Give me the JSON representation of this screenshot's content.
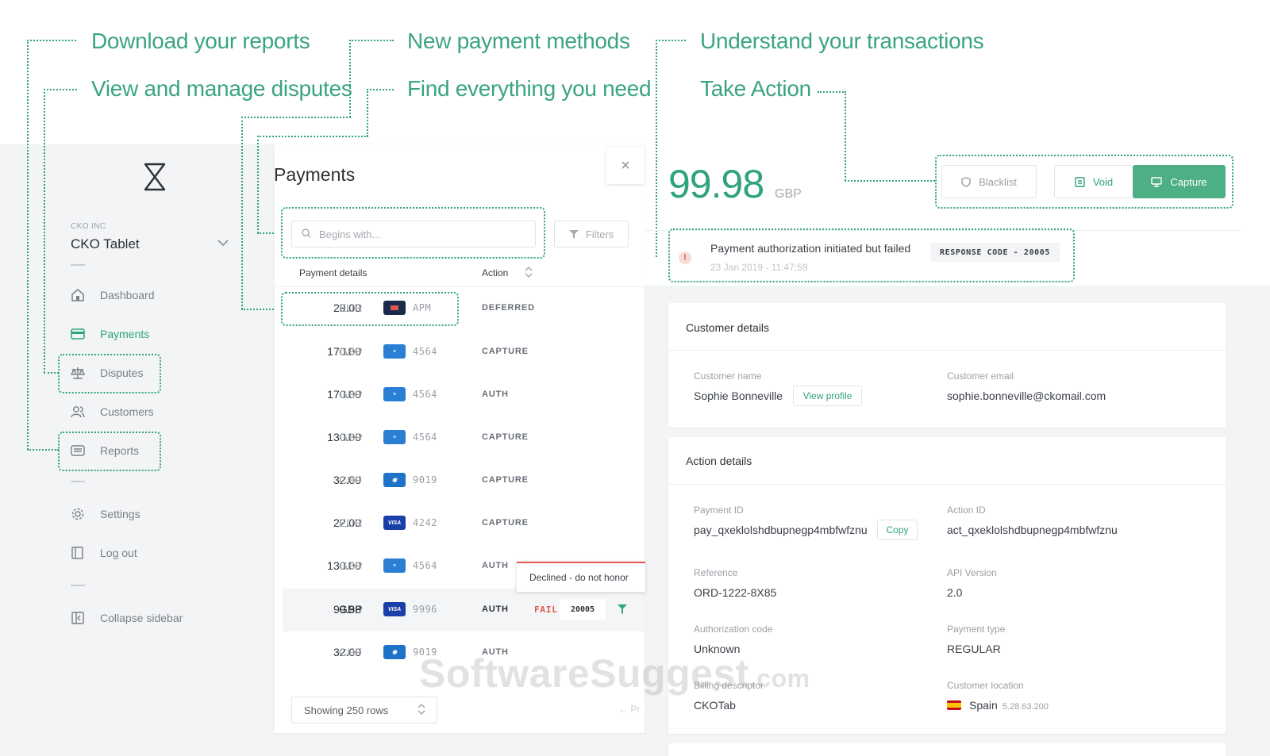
{
  "callouts": {
    "download_reports": "Download your reports",
    "view_disputes": "View and manage disputes",
    "new_payment_methods": "New payment methods",
    "find_everything": "Find everything you need",
    "understand_transactions": "Understand your transactions",
    "take_action": "Take Action"
  },
  "sidebar": {
    "org_sub": "CKO INC",
    "org_name": "CKO Tablet",
    "items": [
      {
        "label": "Dashboard",
        "icon": "dashboard-icon"
      },
      {
        "label": "Payments",
        "icon": "payments-icon",
        "active": true
      },
      {
        "label": "Disputes",
        "icon": "scales-icon"
      },
      {
        "label": "Customers",
        "icon": "customers-icon"
      },
      {
        "label": "Reports",
        "icon": "reports-icon"
      },
      {
        "label": "Settings",
        "icon": "gear-icon"
      },
      {
        "label": "Log out",
        "icon": "logout-icon"
      },
      {
        "label": "Collapse sidebar",
        "icon": "collapse-icon"
      }
    ]
  },
  "payments": {
    "title": "Payments",
    "close": "×",
    "search_placeholder": "Begins with...",
    "filters_label": "Filters",
    "col_details": "Payment details",
    "col_action": "Action",
    "rows": [
      {
        "amount": "29.00",
        "currency": "EUR",
        "method": "APM",
        "action": "DEFERRED"
      },
      {
        "amount": "170.00",
        "currency": "GBP",
        "method": "4564",
        "action": "CAPTURE"
      },
      {
        "amount": "170.00",
        "currency": "GBP",
        "method": "4564",
        "action": "AUTH"
      },
      {
        "amount": "130.00",
        "currency": "GBP",
        "method": "4564",
        "action": "CAPTURE"
      },
      {
        "amount": "32.00",
        "currency": "CHF",
        "method": "9019",
        "action": "CAPTURE"
      },
      {
        "amount": "22.00",
        "currency": "EUR",
        "method": "4242",
        "action": "CAPTURE"
      },
      {
        "amount": "130.00",
        "currency": "GBP",
        "method": "4564",
        "action": "AUTH"
      },
      {
        "amount": "99.98",
        "currency": "GBP",
        "method": "9996",
        "action": "AUTH",
        "status": "FAIL",
        "code": "20005"
      },
      {
        "amount": "32.00",
        "currency": "CHF",
        "method": "9019",
        "action": "AUTH"
      }
    ],
    "tooltip": "Declined - do not honor",
    "showing": "Showing 250 rows",
    "prev": "← Pr"
  },
  "detail": {
    "amount": "99.98",
    "currency": "GBP",
    "buttons": {
      "blacklist": "Blacklist",
      "void": "Void",
      "capture": "Capture"
    },
    "alert_message": "Payment authorization initiated but failed",
    "alert_time": "23 Jan 2019 - 11:47:59",
    "response_code": "RESPONSE CODE - 20005",
    "customer": {
      "title": "Customer details",
      "name_label": "Customer name",
      "name": "Sophie Bonneville",
      "view_profile": "View profile",
      "email_label": "Customer email",
      "email": "sophie.bonneville@ckomail.com"
    },
    "action": {
      "title": "Action details",
      "payment_id_label": "Payment ID",
      "payment_id": "pay_qxeklolshdbupnegp4mbfwfznu",
      "copy": "Copy",
      "action_id_label": "Action ID",
      "action_id": "act_qxeklolshdbupnegp4mbfwfznu",
      "reference_label": "Reference",
      "reference": "ORD-1222-8X85",
      "api_version_label": "API Version",
      "api_version": "2.0",
      "auth_code_label": "Authorization code",
      "auth_code": "Unknown",
      "payment_type_label": "Payment type",
      "payment_type": "REGULAR",
      "billing_label": "Billing descriptor",
      "billing": "CKOTab",
      "location_label": "Customer location",
      "location_country": "Spain",
      "location_ip": "5.28.63.200"
    }
  },
  "watermark": {
    "main": "SoftwareSuggest",
    "suffix": ".com"
  },
  "colors": {
    "accent": "#2fa37a",
    "danger": "#e0574f",
    "background": "#f3f4f5"
  }
}
